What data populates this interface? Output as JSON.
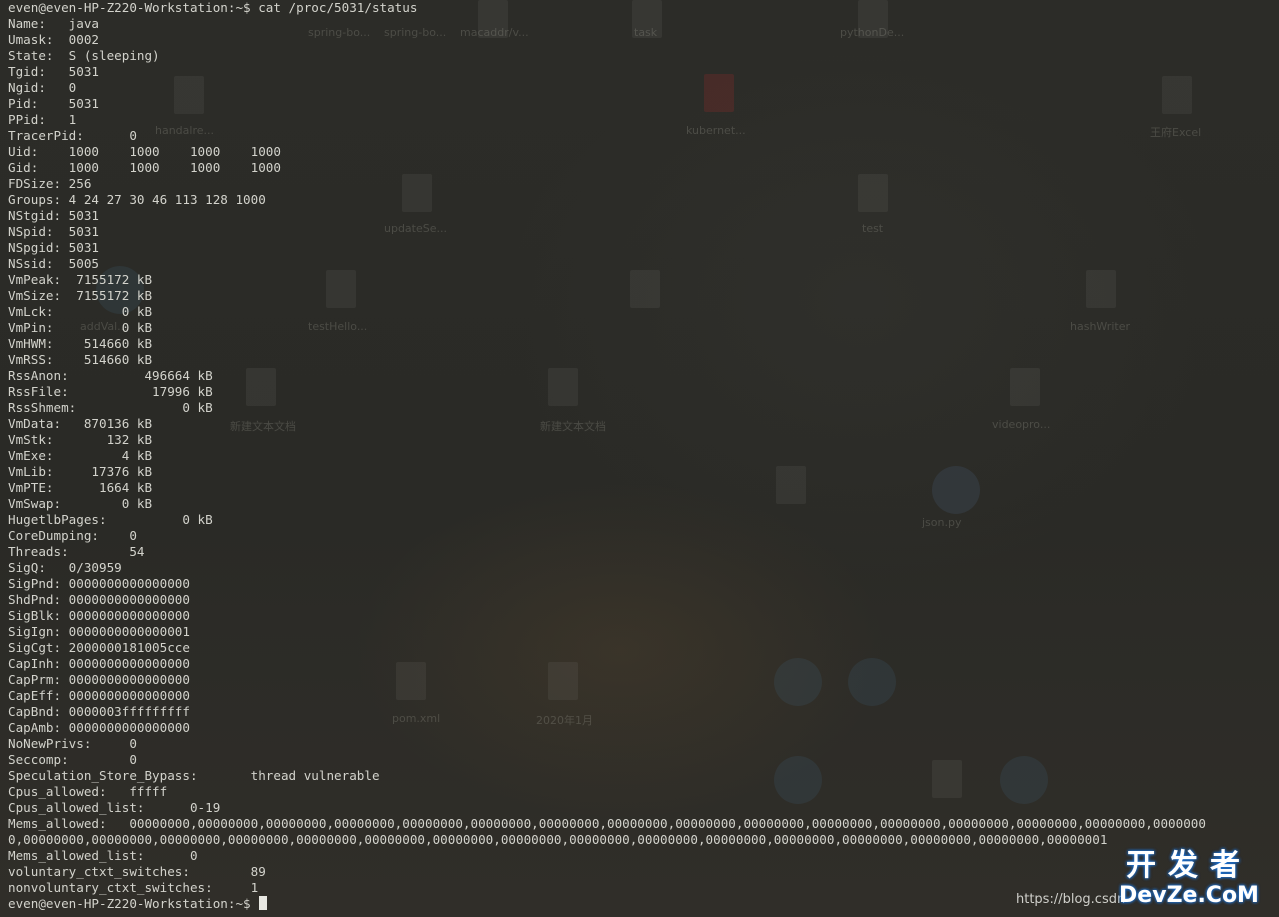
{
  "terminal": {
    "prompt_command": "even@even-HP-Z220-Workstation:~$ cat /proc/5031/status",
    "lines": [
      "Name:   java",
      "Umask:  0002",
      "State:  S (sleeping)",
      "Tgid:   5031",
      "Ngid:   0",
      "Pid:    5031",
      "PPid:   1",
      "TracerPid:      0",
      "Uid:    1000    1000    1000    1000",
      "Gid:    1000    1000    1000    1000",
      "FDSize: 256",
      "Groups: 4 24 27 30 46 113 128 1000",
      "NStgid: 5031",
      "NSpid:  5031",
      "NSpgid: 5031",
      "NSsid:  5005",
      "VmPeak:  7155172 kB",
      "VmSize:  7155172 kB",
      "VmLck:         0 kB",
      "VmPin:         0 kB",
      "VmHWM:    514660 kB",
      "VmRSS:    514660 kB",
      "RssAnon:          496664 kB",
      "RssFile:           17996 kB",
      "RssShmem:              0 kB",
      "VmData:   870136 kB",
      "VmStk:       132 kB",
      "VmExe:         4 kB",
      "VmLib:     17376 kB",
      "VmPTE:      1664 kB",
      "VmSwap:        0 kB",
      "HugetlbPages:          0 kB",
      "CoreDumping:    0",
      "Threads:        54",
      "SigQ:   0/30959",
      "SigPnd: 0000000000000000",
      "ShdPnd: 0000000000000000",
      "SigBlk: 0000000000000000",
      "SigIgn: 0000000000000001",
      "SigCgt: 2000000181005cce",
      "CapInh: 0000000000000000",
      "CapPrm: 0000000000000000",
      "CapEff: 0000000000000000",
      "CapBnd: 0000003fffffffff",
      "CapAmb: 0000000000000000",
      "NoNewPrivs:     0",
      "Seccomp:        0",
      "Speculation_Store_Bypass:       thread vulnerable",
      "Cpus_allowed:   fffff",
      "Cpus_allowed_list:      0-19",
      "Mems_allowed:   00000000,00000000,00000000,00000000,00000000,00000000,00000000,00000000,00000000,00000000,00000000,00000000,00000000,00000000,00000000,0000000",
      "0,00000000,00000000,00000000,00000000,00000000,00000000,00000000,00000000,00000000,00000000,00000000,00000000,00000000,00000000,00000000,00000001",
      "Mems_allowed_list:      0",
      "voluntary_ctxt_switches:        89",
      "nonvoluntary_ctxt_switches:     1"
    ],
    "final_prompt": "even@even-HP-Z220-Workstation:~$ "
  },
  "desktop": {
    "icon_labels": [
      "spring-bo...",
      "spring-bo...",
      "macaddr/v...",
      "task",
      "pythonDe...",
      "handalre...",
      "kubernet...",
      "王府Excel",
      "updateSe...",
      "test",
      "addVal...",
      "testHello...",
      "hashWriter",
      "新建文本文档",
      "新建文本文档",
      "videopro...",
      "json.py",
      "pom.xml",
      "2020年1月"
    ]
  },
  "watermark": {
    "title": "开发者",
    "subtitle": "DevZe.CoM",
    "url": "https://blog.csdn"
  }
}
